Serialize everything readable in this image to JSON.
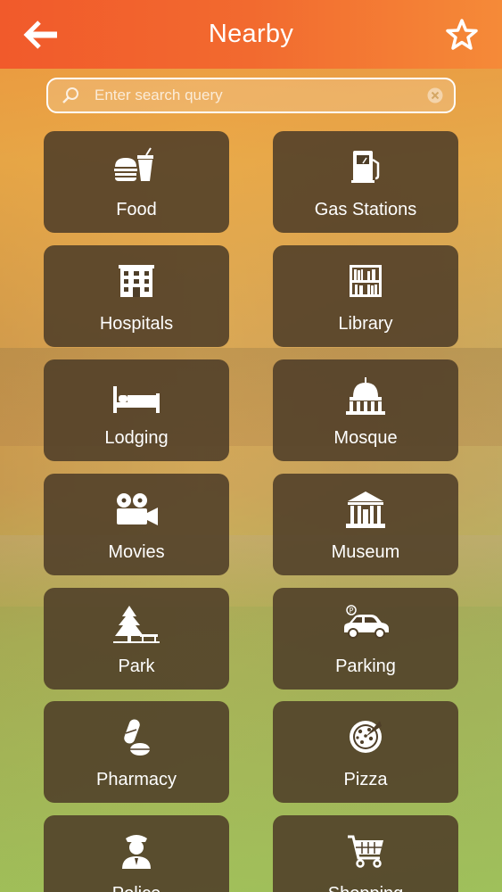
{
  "header": {
    "title": "Nearby",
    "back_icon": "back-arrow-icon",
    "favorite_icon": "star-icon"
  },
  "search": {
    "placeholder": "Enter search query",
    "value": ""
  },
  "colors": {
    "header_start": "#f15a2b",
    "header_end": "#f58a38",
    "tile": "#4e3e28"
  },
  "categories": [
    {
      "label": "Food",
      "icon": "fastfood-icon"
    },
    {
      "label": "Gas Stations",
      "icon": "gas-pump-icon"
    },
    {
      "label": "Hospitals",
      "icon": "hospital-icon"
    },
    {
      "label": "Library",
      "icon": "bookshelf-icon"
    },
    {
      "label": "Lodging",
      "icon": "bed-icon"
    },
    {
      "label": "Mosque",
      "icon": "dome-icon"
    },
    {
      "label": "Movies",
      "icon": "movie-camera-icon"
    },
    {
      "label": "Museum",
      "icon": "museum-icon"
    },
    {
      "label": "Park",
      "icon": "tree-icon"
    },
    {
      "label": "Parking",
      "icon": "car-icon"
    },
    {
      "label": "Pharmacy",
      "icon": "pill-icon"
    },
    {
      "label": "Pizza",
      "icon": "pizza-icon"
    },
    {
      "label": "Police",
      "icon": "police-officer-icon"
    },
    {
      "label": "Shopping",
      "icon": "shopping-cart-icon"
    }
  ]
}
